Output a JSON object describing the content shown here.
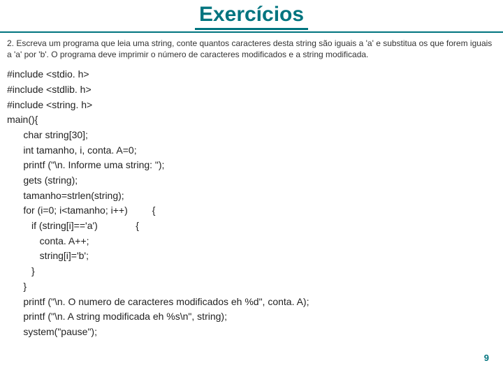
{
  "title": "Exercícios",
  "description": "2. Escreva um programa que leia uma string, conte quantos caracteres desta string são iguais a 'a' e substitua os que forem iguais a 'a' por 'b'. O programa deve imprimir o número de caracteres modificados e a string modificada.",
  "code_lines": [
    "#include <stdio. h>",
    "#include <stdlib. h>",
    "#include <string. h>",
    "main(){",
    "      char string[30];",
    "      int tamanho, i, conta. A=0;",
    "      printf (\"\\n. Informe uma string: \");",
    "      gets (string);",
    "      tamanho=strlen(string);",
    "      for (i=0; i<tamanho; i++)         {",
    "         if (string[i]=='a')              {",
    "            conta. A++;",
    "            string[i]='b';",
    "         }",
    "      }",
    "      printf (\"\\n. O numero de caracteres modificados eh %d\", conta. A);",
    "      printf (\"\\n. A string modificada eh %s\\n\", string);",
    "      system(\"pause\");"
  ],
  "page_number": "9"
}
